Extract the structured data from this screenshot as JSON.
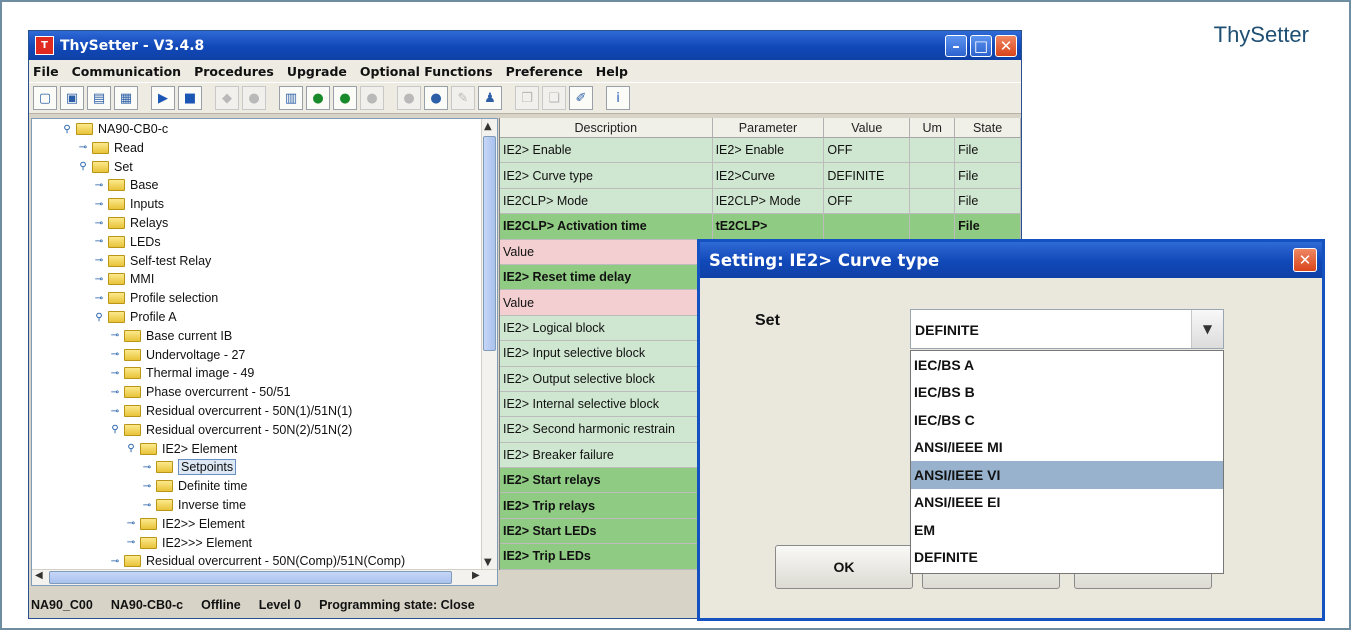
{
  "brand": "ThySetter",
  "window": {
    "title": "ThySetter - V3.4.8",
    "icon_text": "T"
  },
  "menu": [
    "File",
    "Communication",
    "Procedures",
    "Upgrade",
    "Optional Functions",
    "Preference",
    "Help"
  ],
  "toolbar": [
    {
      "name": "new-file-icon",
      "glyph": "▢",
      "style": ""
    },
    {
      "name": "open-folder-icon",
      "glyph": "▣",
      "style": ""
    },
    {
      "name": "open-recent-icon",
      "glyph": "▤",
      "style": ""
    },
    {
      "name": "save-icon",
      "glyph": "▦",
      "style": ""
    },
    {
      "name": "play-icon",
      "glyph": "▶",
      "style": "gap blue"
    },
    {
      "name": "stop-icon",
      "glyph": "■",
      "style": "blue"
    },
    {
      "name": "read-icon",
      "glyph": "◆",
      "style": "gap dim"
    },
    {
      "name": "write-icon",
      "glyph": "●",
      "style": "dim"
    },
    {
      "name": "device-icon",
      "glyph": "▥",
      "style": "gap"
    },
    {
      "name": "download-icon",
      "glyph": "●",
      "style": "green"
    },
    {
      "name": "upload-icon",
      "glyph": "●",
      "style": "green"
    },
    {
      "name": "compare-icon",
      "glyph": "●",
      "style": "dim"
    },
    {
      "name": "record-icon",
      "glyph": "●",
      "style": "gap dim"
    },
    {
      "name": "bomb-icon",
      "glyph": "●",
      "style": ""
    },
    {
      "name": "pen-icon",
      "glyph": "✎",
      "style": "dim"
    },
    {
      "name": "person-icon",
      "glyph": "♟",
      "style": ""
    },
    {
      "name": "copy-icon",
      "glyph": "❐",
      "style": "gap dim"
    },
    {
      "name": "paste-icon",
      "glyph": "❏",
      "style": "dim"
    },
    {
      "name": "edit-icon",
      "glyph": "✐",
      "style": ""
    },
    {
      "name": "info-icon",
      "glyph": "i",
      "style": "gap blue"
    }
  ],
  "tree": [
    {
      "label": "NA90-CB0-c",
      "indent": 0,
      "open": true
    },
    {
      "label": "Read",
      "indent": 1,
      "open": false
    },
    {
      "label": "Set",
      "indent": 1,
      "open": true
    },
    {
      "label": "Base",
      "indent": 2,
      "open": false
    },
    {
      "label": "Inputs",
      "indent": 2,
      "open": false
    },
    {
      "label": "Relays",
      "indent": 2,
      "open": false
    },
    {
      "label": "LEDs",
      "indent": 2,
      "open": false
    },
    {
      "label": "Self-test Relay",
      "indent": 2,
      "open": false
    },
    {
      "label": "MMI",
      "indent": 2,
      "open": false
    },
    {
      "label": "Profile selection",
      "indent": 2,
      "open": false
    },
    {
      "label": "Profile A",
      "indent": 2,
      "open": true
    },
    {
      "label": "Base current IB",
      "indent": 3,
      "open": false
    },
    {
      "label": "Undervoltage - 27",
      "indent": 3,
      "open": false
    },
    {
      "label": "Thermal image - 49",
      "indent": 3,
      "open": false
    },
    {
      "label": "Phase overcurrent - 50/51",
      "indent": 3,
      "open": false
    },
    {
      "label": "Residual overcurrent - 50N(1)/51N(1)",
      "indent": 3,
      "open": false
    },
    {
      "label": "Residual overcurrent - 50N(2)/51N(2)",
      "indent": 3,
      "open": true
    },
    {
      "label": "IE2> Element",
      "indent": 4,
      "open": true
    },
    {
      "label": "Setpoints",
      "indent": 5,
      "open": false,
      "selected": true
    },
    {
      "label": "Definite time",
      "indent": 5,
      "open": false
    },
    {
      "label": "Inverse time",
      "indent": 5,
      "open": false
    },
    {
      "label": "IE2>> Element",
      "indent": 4,
      "open": false
    },
    {
      "label": "IE2>>> Element",
      "indent": 4,
      "open": false
    },
    {
      "label": "Residual overcurrent - 50N(Comp)/51N(Comp)",
      "indent": 3,
      "open": false
    }
  ],
  "table": {
    "headers": [
      "Description",
      "Parameter",
      "Value",
      "Um",
      "State"
    ],
    "rows": [
      {
        "cells": [
          "IE2> Enable",
          "IE2> Enable",
          "OFF",
          "",
          "File"
        ],
        "style": "light"
      },
      {
        "cells": [
          "IE2> Curve type",
          "IE2>Curve",
          "DEFINITE",
          "",
          "File"
        ],
        "style": "light"
      },
      {
        "cells": [
          "IE2CLP> Mode",
          "IE2CLP> Mode",
          "OFF",
          "",
          "File"
        ],
        "style": "light"
      },
      {
        "cells": [
          "IE2CLP> Activation time",
          "tE2CLP>",
          "",
          "",
          "File"
        ],
        "style": "dark"
      },
      {
        "cells": [
          "Value",
          "",
          "",
          "",
          ""
        ],
        "style": "pink"
      },
      {
        "cells": [
          "IE2> Reset time delay",
          "",
          "",
          "",
          ""
        ],
        "style": "dark"
      },
      {
        "cells": [
          "Value",
          "",
          "",
          "",
          ""
        ],
        "style": "pink"
      },
      {
        "cells": [
          "IE2> Logical block",
          "",
          "",
          "",
          ""
        ],
        "style": "light"
      },
      {
        "cells": [
          "IE2> Input selective block",
          "",
          "",
          "",
          ""
        ],
        "style": "light"
      },
      {
        "cells": [
          "IE2> Output selective block",
          "",
          "",
          "",
          ""
        ],
        "style": "light"
      },
      {
        "cells": [
          "IE2> Internal selective block",
          "",
          "",
          "",
          ""
        ],
        "style": "light"
      },
      {
        "cells": [
          "IE2> Second harmonic restrain",
          "",
          "",
          "",
          ""
        ],
        "style": "light"
      },
      {
        "cells": [
          "IE2> Breaker failure",
          "",
          "",
          "",
          ""
        ],
        "style": "light"
      },
      {
        "cells": [
          "IE2> Start relays",
          "",
          "",
          "",
          ""
        ],
        "style": "dark"
      },
      {
        "cells": [
          "IE2> Trip relays",
          "",
          "",
          "",
          ""
        ],
        "style": "dark"
      },
      {
        "cells": [
          "IE2> Start LEDs",
          "",
          "",
          "",
          ""
        ],
        "style": "dark"
      },
      {
        "cells": [
          "IE2> Trip LEDs",
          "",
          "",
          "",
          ""
        ],
        "style": "dark"
      }
    ]
  },
  "status": [
    "NA90_C00",
    "NA90-CB0-c",
    "Offline",
    "Level 0",
    "Programming state: Close"
  ],
  "dialog": {
    "title": "Setting: IE2> Curve type",
    "set_label": "Set",
    "selected": "DEFINITE",
    "options": [
      "IEC/BS A",
      "IEC/BS B",
      "IEC/BS C",
      "ANSI/IEEE MI",
      "ANSI/IEEE VI",
      "ANSI/IEEE EI",
      "EM",
      "DEFINITE"
    ],
    "highlighted": "ANSI/IEEE VI",
    "ok_label": "OK"
  }
}
